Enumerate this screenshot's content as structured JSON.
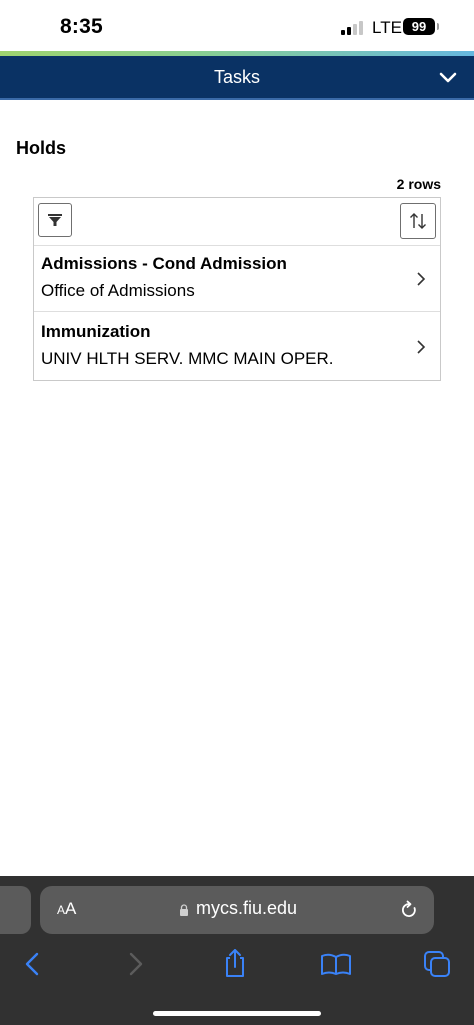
{
  "status_bar": {
    "time": "8:35",
    "network": "LTE",
    "battery": "99"
  },
  "header": {
    "title": "Tasks",
    "menu_icon": "chevron-down-icon"
  },
  "holds": {
    "title": "Holds",
    "row_count": "2 rows",
    "filter_icon": "filter-icon",
    "sort_icon": "sort-icon",
    "rows": [
      {
        "name": "Admissions - Cond Admission",
        "department": "Office of Admissions"
      },
      {
        "name": "Immunization",
        "department": "UNIV HLTH SERV. MMC MAIN OPER."
      }
    ]
  },
  "browser": {
    "text_size_label_small": "A",
    "text_size_label_large": "A",
    "url": "mycs.fiu.edu",
    "accent_color": "#3a82f7"
  },
  "colors": {
    "header_bg": "#0a3264",
    "browser_bg": "#313131"
  }
}
